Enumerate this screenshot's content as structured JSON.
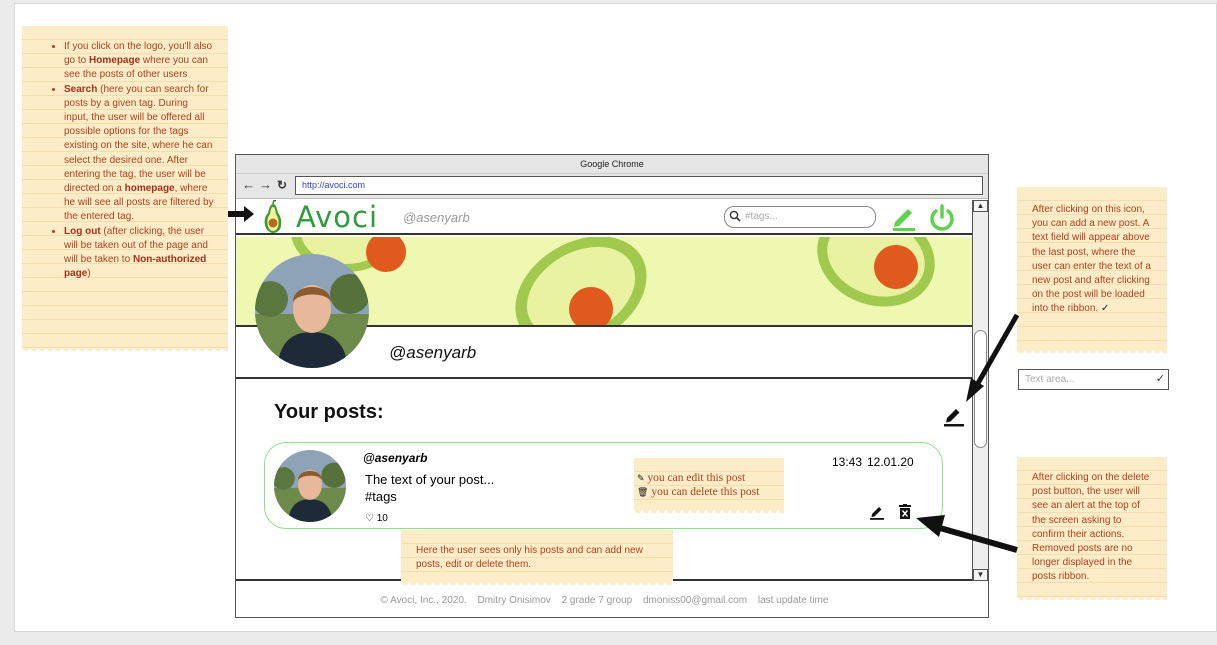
{
  "notes": {
    "left": {
      "items": [
        {
          "pre": "If you click on the logo, you'll also go to ",
          "bold": "Homepage",
          "post": " where you can see the posts of other users"
        },
        {
          "pre": "",
          "bold": "Search",
          "post": " (here you can search for posts by a given tag. During input, the user will be offered all possible options for the tags existing on the site, where he can select the desired one. After entering the tag, the user will be directed on a "
        },
        {
          "pre": "",
          "bold": "Log out",
          "post": " (after clicking, the user will be taken out of the page and will be taken to "
        }
      ],
      "search_bold2": "homepage",
      "search_tail": ", where he will see all posts are filtered by the entered tag.",
      "logout_bold2": "Non-authorized page",
      "logout_tail": ")"
    },
    "top_right": "After clicking on this icon, you can add a new post. A text field will appear above the last post, where the user can enter the text of a new post and after clicking on the post will be loaded into the ribbon.",
    "bottom_right": "After clicking on the delete post button, the user will see an alert at the top of the screen asking to confirm their actions. Removed posts are no longer displayed in the posts ribbon.",
    "bottom_center": "Here the user sees only his posts and can add new posts, edit or delete them.",
    "tip_edit": "you can edit this post",
    "tip_delete": "you can delete this post"
  },
  "browser": {
    "title": "Google Chrome",
    "url": "http://avoci.com",
    "back": "←",
    "forward": "→",
    "reload": "↻"
  },
  "app": {
    "logo": "Avoci",
    "header_user": "@asenyarb",
    "search_placeholder": "#tags...",
    "profile_name": "@asenyarb",
    "posts_title": "Your posts:"
  },
  "post": {
    "user": "@asenyarb",
    "text": "The text of your post...",
    "tags": "#tags",
    "likes": "10",
    "time": "13:43",
    "date": "12.01.20"
  },
  "footer": {
    "copyright": "© Avoci, Inc., 2020.",
    "author": "Dmitry Onisimov",
    "group": "2 grade 7 group",
    "email": "dmoniss00@gmail.com",
    "update": "last update time"
  },
  "textarea_placeholder": "Text area...",
  "colors": {
    "brand": "#2e9c3a",
    "accent_green": "#5fd14f",
    "note": "#fdecc8",
    "note_text": "#b0401e",
    "banner": "#eef8b0"
  }
}
